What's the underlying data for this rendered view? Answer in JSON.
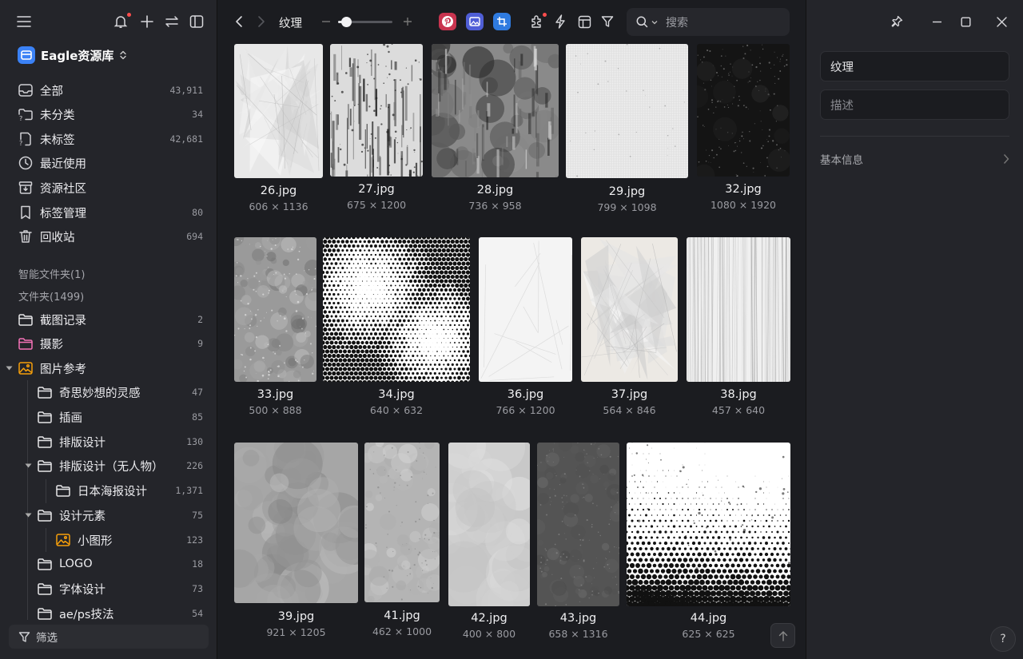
{
  "sidebar": {
    "library_name": "Eagle资源库",
    "nav": [
      {
        "label": "全部",
        "count": "43,911",
        "icon": "inbox-icon"
      },
      {
        "label": "未分类",
        "count": "34",
        "icon": "folder-question-icon"
      },
      {
        "label": "未标签",
        "count": "42,681",
        "icon": "tag-question-icon"
      },
      {
        "label": "最近使用",
        "count": "",
        "icon": "clock-icon"
      },
      {
        "label": "资源社区",
        "count": "",
        "icon": "archive-icon"
      },
      {
        "label": "标签管理",
        "count": "80",
        "icon": "bookmark-icon"
      },
      {
        "label": "回收站",
        "count": "694",
        "icon": "trash-icon"
      }
    ],
    "smart_folders_label": "智能文件夹(1)",
    "folders_label": "文件夹(1499)",
    "folders": [
      {
        "label": "截图记录",
        "count": "2",
        "icon": "folder-icon",
        "color": "#e6e6e8"
      },
      {
        "label": "摄影",
        "count": "9",
        "icon": "folder-icon",
        "color": "#f472b6"
      },
      {
        "label": "图片参考",
        "count": "",
        "icon": "image-folder-icon",
        "color": "#f59e0b"
      },
      {
        "label": "奇思妙想的灵感",
        "count": "47",
        "icon": "folder-icon",
        "color": "#e6e6e8"
      },
      {
        "label": "插画",
        "count": "85",
        "icon": "folder-icon",
        "color": "#e6e6e8"
      },
      {
        "label": "排版设计",
        "count": "130",
        "icon": "folder-icon",
        "color": "#e6e6e8"
      },
      {
        "label": "排版设计（无人物）",
        "count": "226",
        "icon": "folder-icon",
        "color": "#e6e6e8"
      },
      {
        "label": "日本海报设计",
        "count": "1,371",
        "icon": "folder-icon",
        "color": "#e6e6e8"
      },
      {
        "label": "设计元素",
        "count": "75",
        "icon": "folder-icon",
        "color": "#e6e6e8"
      },
      {
        "label": "小图形",
        "count": "123",
        "icon": "image-folder-icon",
        "color": "#f59e0b"
      },
      {
        "label": "LOGO",
        "count": "18",
        "icon": "folder-icon",
        "color": "#e6e6e8"
      },
      {
        "label": "字体设计",
        "count": "73",
        "icon": "folder-icon",
        "color": "#e6e6e8"
      },
      {
        "label": "ae/ps技法",
        "count": "54",
        "icon": "folder-icon",
        "color": "#e6e6e8"
      }
    ],
    "filter_label": "筛选"
  },
  "toolbar": {
    "breadcrumb": "纹理",
    "zoom_fraction": 0.15,
    "search_placeholder": "搜索"
  },
  "grid": {
    "items": [
      {
        "name": "26.jpg",
        "dims": "606 × 1136",
        "texture": "crumpled-light"
      },
      {
        "name": "27.jpg",
        "dims": "675 × 1200",
        "texture": "grunge-light"
      },
      {
        "name": "28.jpg",
        "dims": "736 × 958",
        "texture": "grunge-dark"
      },
      {
        "name": "29.jpg",
        "dims": "799 × 1098",
        "texture": "paper-grid"
      },
      {
        "name": "32.jpg",
        "dims": "1080 × 1920",
        "texture": "dark-speckle"
      },
      {
        "name": "33.jpg",
        "dims": "500 × 888",
        "texture": "concrete-mid"
      },
      {
        "name": "34.jpg",
        "dims": "640 × 632",
        "texture": "halftone"
      },
      {
        "name": "36.jpg",
        "dims": "766 × 1200",
        "texture": "paper-white"
      },
      {
        "name": "37.jpg",
        "dims": "564 × 846",
        "texture": "crumpled-warm"
      },
      {
        "name": "38.jpg",
        "dims": "457 × 640",
        "texture": "wood-light"
      },
      {
        "name": "39.jpg",
        "dims": "921 × 1205",
        "texture": "cloud-gray"
      },
      {
        "name": "41.jpg",
        "dims": "462 × 1000",
        "texture": "concrete-light"
      },
      {
        "name": "42.jpg",
        "dims": "400 × 800",
        "texture": "watercolor-light"
      },
      {
        "name": "43.jpg",
        "dims": "658 × 1316",
        "texture": "concrete-dark"
      },
      {
        "name": "44.jpg",
        "dims": "625 × 625",
        "texture": "halftone-gradient"
      }
    ]
  },
  "inspector": {
    "title_value": "纹理",
    "description_placeholder": "描述",
    "basic_info_label": "基本信息",
    "help_label": "?"
  },
  "colors": {
    "accent": "#3b82f6",
    "notification_dot": "#ff4d4d",
    "pinterest": "#e03e5a",
    "app_blue_a": "#5b6ff0",
    "app_blue_b": "#3b8df0"
  }
}
